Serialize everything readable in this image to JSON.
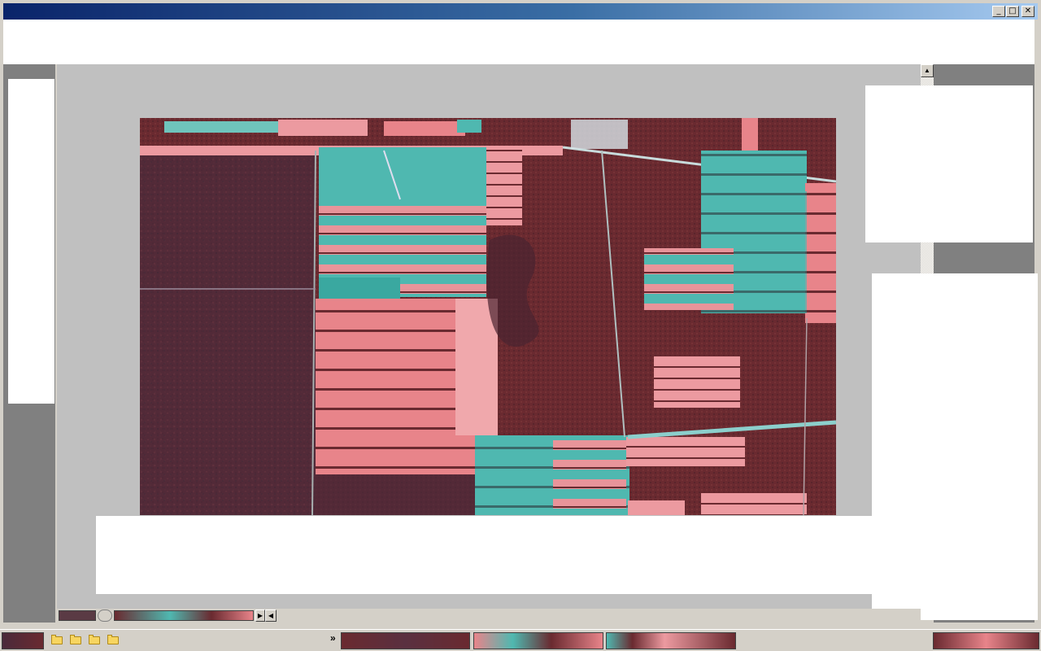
{
  "window": {
    "title": "",
    "controls": {
      "minimize": "_",
      "maximize": "□",
      "close": "✕"
    }
  },
  "colors": {
    "titlebar_start": "#0a246a",
    "titlebar_end": "#a6caf0",
    "viewport_bg": "#c0c0c0",
    "panel_gray": "#808080",
    "forest": "#6a2a30",
    "field_pink": "#e8848a",
    "field_cyan": "#4fb8b0"
  },
  "viewer": {
    "image_icon": "satellite-image-icon",
    "scroll_up": "▲",
    "scroll_right": "▶",
    "scroll_left": "◀"
  },
  "taskbar": {
    "overflow_label": "»",
    "folders": [
      "folder-icon",
      "folder-icon",
      "folder-icon",
      "folder-icon"
    ]
  }
}
